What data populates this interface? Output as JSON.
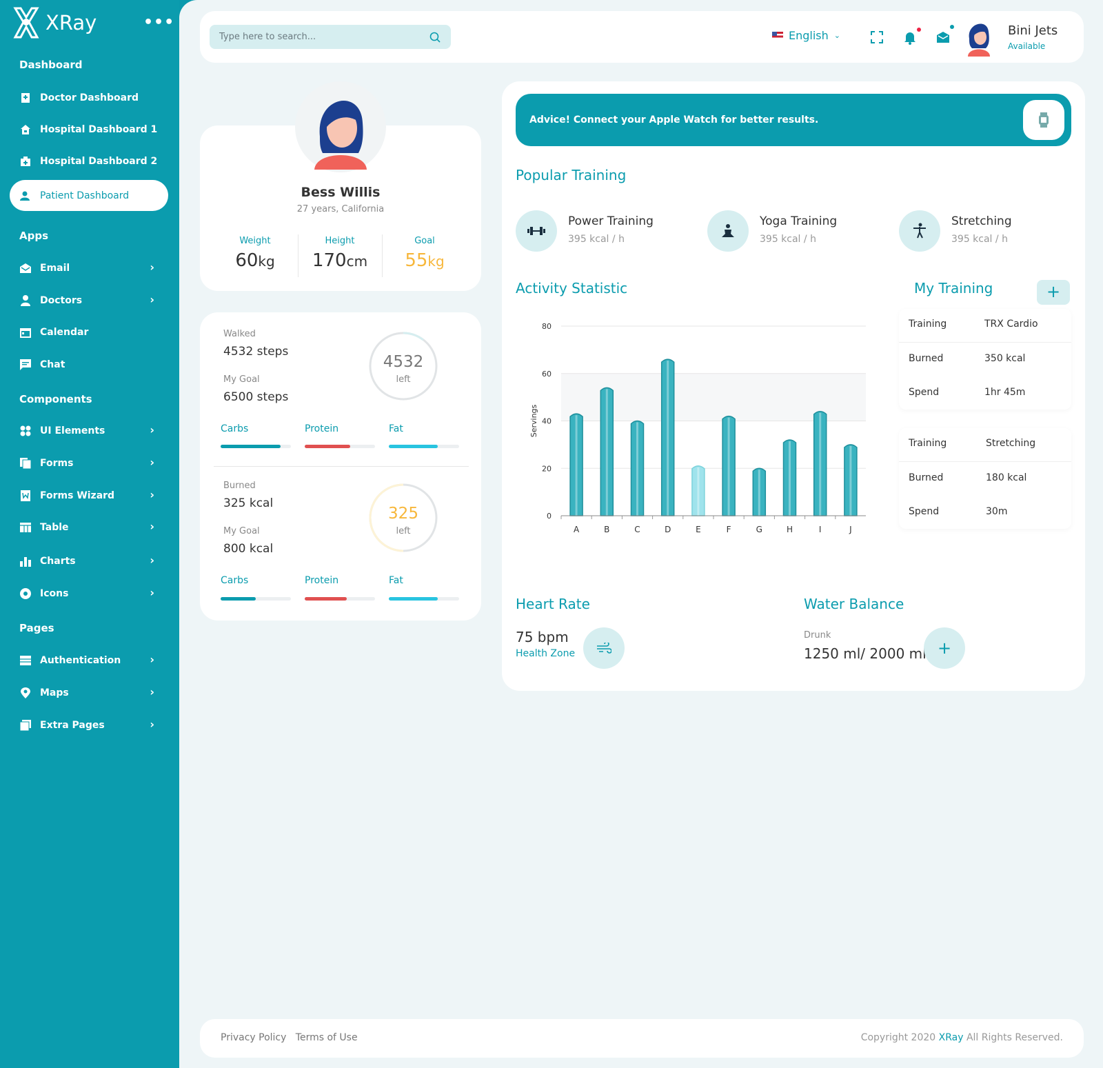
{
  "brand": {
    "name": "XRay"
  },
  "sidebar": {
    "sections": [
      "Dashboard",
      "Apps",
      "Components",
      "Pages"
    ],
    "items": [
      {
        "label": "Doctor Dashboard",
        "icon": "doctor-icon"
      },
      {
        "label": "Hospital Dashboard 1",
        "icon": "home-icon"
      },
      {
        "label": "Hospital Dashboard 2",
        "icon": "hospital-icon"
      },
      {
        "label": "Patient Dashboard",
        "icon": "patient-icon",
        "active": true
      },
      {
        "label": "Email",
        "icon": "mail-icon"
      },
      {
        "label": "Doctors",
        "icon": "user-icon"
      },
      {
        "label": "Calendar",
        "icon": "calendar-icon"
      },
      {
        "label": "Chat",
        "icon": "chat-icon"
      },
      {
        "label": "UI Elements",
        "icon": "grid-icon"
      },
      {
        "label": "Forms",
        "icon": "forms-icon"
      },
      {
        "label": "Forms Wizard",
        "icon": "wizard-icon"
      },
      {
        "label": "Table",
        "icon": "table-icon"
      },
      {
        "label": "Charts",
        "icon": "chart-icon"
      },
      {
        "label": "Icons",
        "icon": "icons-icon"
      },
      {
        "label": "Authentication",
        "icon": "auth-icon"
      },
      {
        "label": "Maps",
        "icon": "map-pin-icon"
      },
      {
        "label": "Extra Pages",
        "icon": "pages-icon"
      }
    ]
  },
  "header": {
    "search_placeholder": "Type here to search...",
    "language": "English",
    "user_name": "Bini Jets",
    "user_status": "Available"
  },
  "profile": {
    "name": "Bess Willis",
    "subtitle": "27 years, California",
    "weight_label": "Weight",
    "weight_value": "60",
    "weight_unit": "kg",
    "height_label": "Height",
    "height_value": "170",
    "height_unit": "cm",
    "goal_label": "Goal",
    "goal_value": "55",
    "goal_unit": "kg"
  },
  "steps": {
    "walked_label": "Walked",
    "walked_value": "4532 steps",
    "goal_label": "My Goal",
    "goal_value": "6500 steps",
    "ring_value": "4532",
    "ring_sub": "left",
    "carbs": "Carbs",
    "protein": "Protein",
    "fat": "Fat",
    "carbs_pct": 0.85,
    "protein_pct": 0.65,
    "fat_pct": 0.7
  },
  "calories": {
    "burned_label": "Burned",
    "burned_value": "325 kcal",
    "goal_label": "My Goal",
    "goal_value": "800 kcal",
    "ring_value": "325",
    "ring_sub": "left",
    "carbs": "Carbs",
    "protein": "Protein",
    "fat": "Fat",
    "carbs_pct": 0.5,
    "protein_pct": 0.6,
    "fat_pct": 0.7
  },
  "advice": {
    "text": "Advice! Connect your Apple Watch for better results."
  },
  "popular": {
    "title": "Popular Training",
    "items": [
      {
        "name": "Power Training",
        "kcal": "395 kcal / h",
        "icon": "dumbbell-icon"
      },
      {
        "name": "Yoga Training",
        "kcal": "395 kcal / h",
        "icon": "yoga-icon"
      },
      {
        "name": "Stretching",
        "kcal": "395 kcal / h",
        "icon": "stretch-icon"
      }
    ]
  },
  "activity": {
    "title": "Activity Statistic"
  },
  "chart_data": {
    "type": "bar",
    "categories": [
      "A",
      "B",
      "C",
      "D",
      "E",
      "F",
      "G",
      "H",
      "I",
      "J"
    ],
    "values": [
      43,
      54,
      40,
      66,
      21,
      42,
      20,
      32,
      44,
      30
    ],
    "highlight_index": 4,
    "ylabel": "Servings",
    "ylim": [
      0,
      80
    ],
    "yticks": [
      0,
      20,
      40,
      60,
      80
    ],
    "color": "#3ab3c0",
    "highlight_color": "#9fe3ec"
  },
  "my_training": {
    "title": "My Training",
    "cards": [
      {
        "training_label": "Training",
        "training_value": "TRX Cardio",
        "burned_label": "Burned",
        "burned_value": "350 kcal",
        "spend_label": "Spend",
        "spend_value": "1hr 45m"
      },
      {
        "training_label": "Training",
        "training_value": "Stretching",
        "burned_label": "Burned",
        "burned_value": "180 kcal",
        "spend_label": "Spend",
        "spend_value": "30m"
      }
    ]
  },
  "heart": {
    "title": "Heart Rate",
    "value": "75 bpm",
    "sub": "Health Zone"
  },
  "water": {
    "title": "Water Balance",
    "label": "Drunk",
    "value": "1250 ml/ 2000 ml"
  },
  "footer": {
    "privacy": "Privacy Policy",
    "terms": "Terms of Use",
    "copy_pre": "Copyright 2020",
    "copy_brand": "XRay",
    "copy_post": "All Rights Reserved."
  },
  "colors": {
    "primary": "#0b9cae",
    "accent": "#f7b73b",
    "protein": "#e05050",
    "fat": "#28c4e0"
  }
}
